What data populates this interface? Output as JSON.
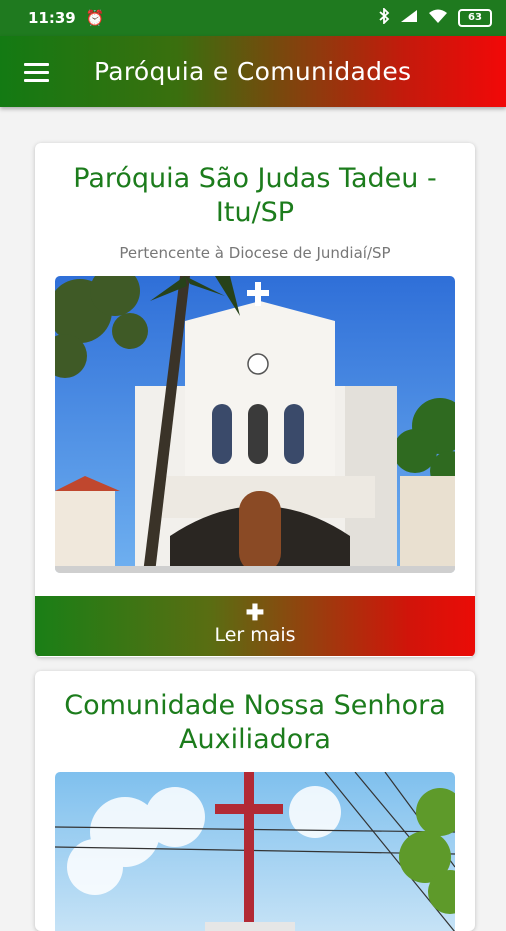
{
  "status_bar": {
    "time": "11:39",
    "alarm_icon": "alarm-clock-icon",
    "bluetooth_icon": "bluetooth-icon",
    "signal_icon": "cell-signal-icon",
    "wifi_icon": "wifi-icon",
    "battery": "63"
  },
  "app_bar": {
    "menu_icon": "hamburger-menu-icon",
    "title": "Paróquia e Comunidades",
    "gradient_start": "#137a13",
    "gradient_end": "#f20808"
  },
  "cards": [
    {
      "title": "Paróquia São Judas Tadeu - Itu/SP",
      "subtitle": "Pertencente à Diocese de Jundiaí/SP",
      "image": "church-photo",
      "button": {
        "icon": "plus-icon",
        "label": "Ler mais"
      }
    },
    {
      "title": "Comunidade Nossa Senhora Auxiliadora",
      "image": "cross-photo"
    }
  ],
  "colors": {
    "title_green": "#1c7c1c",
    "subtitle_gray": "#777777",
    "status_bar": "#1f7a1f"
  }
}
